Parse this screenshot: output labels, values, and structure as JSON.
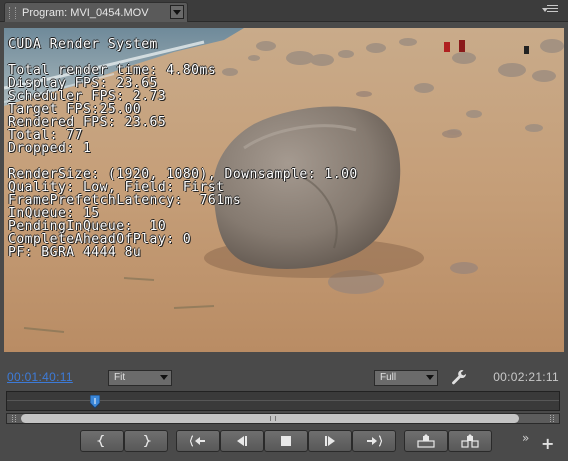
{
  "tab": {
    "title": "Program: MVI_0454.MOV"
  },
  "icons": {
    "tab_dropdown": "chevron-down-icon",
    "panel_menu": "panel-menu-icon",
    "settings": "wrench-icon",
    "playhead": "playhead-icon",
    "more": "chevron-double-right-icon",
    "add": "plus-icon"
  },
  "overlay": {
    "heading": "CUDA Render System",
    "stats": [
      "Total render time: 4.80ms",
      "Display FPS: 23.65",
      "Scheduler FPS: 2.73",
      "Target FPS:25.00",
      "Rendered FPS: 23.65",
      "Total: 77",
      "Dropped: 1"
    ],
    "render": [
      "RenderSize: (1920, 1080), Downsample: 1.00",
      "Quality: Low, Field: First",
      "FramePrefetchLatency:  761ms",
      "InQueue: 15",
      "PendingInQueue:  10",
      "CompleteAheadOfPlay: 0",
      "PF: BGRA 4444 8u"
    ]
  },
  "controls": {
    "current_timecode": "00:01:40:11",
    "duration_timecode": "00:02:21:11",
    "zoom_select": "Fit",
    "resolution_select": "Full",
    "playhead_position": 0.16,
    "more_label": "»",
    "add_label": "+"
  },
  "transport": [
    {
      "name": "mark-in-button",
      "icon": "mark-in-icon"
    },
    {
      "name": "mark-out-button",
      "icon": "mark-out-icon"
    },
    {
      "name": "go-to-in-button",
      "icon": "go-to-in-icon"
    },
    {
      "name": "step-back-button",
      "icon": "step-back-icon"
    },
    {
      "name": "stop-button",
      "icon": "stop-icon"
    },
    {
      "name": "step-forward-button",
      "icon": "step-forward-icon"
    },
    {
      "name": "go-to-out-button",
      "icon": "go-to-out-icon"
    },
    {
      "name": "lift-button",
      "icon": "lift-icon"
    },
    {
      "name": "extract-button",
      "icon": "extract-icon"
    }
  ],
  "colors": {
    "timecode_current": "#3d7bd8",
    "timecode_duration": "#c8c8c8",
    "panel_bg": "#4a4a4a",
    "overlay_text": "#ffffff",
    "playhead": "#3a86d8"
  }
}
